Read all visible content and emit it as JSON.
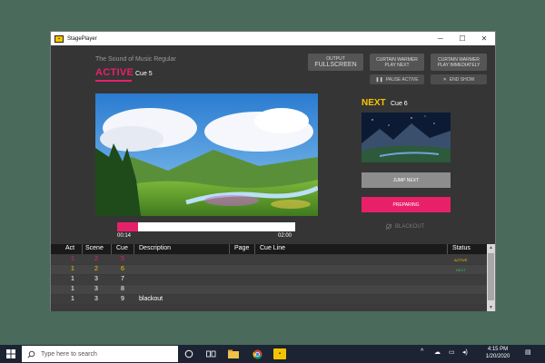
{
  "window": {
    "title": "StagePlayer",
    "minimize": "─",
    "maximize": "☐",
    "close": "✕"
  },
  "active": {
    "show_name": "The Sound of Music Regular",
    "label": "ACTIVE",
    "cue": "Cue 5"
  },
  "controls": {
    "output_line1": "OUTPUT",
    "output_line2": "FULLSCREEN",
    "cw_next_line1": "CURTAIN WARMER",
    "cw_next_line2": "PLAY NEXT",
    "cw_imm_line1": "CURTAIN WARMER",
    "cw_imm_line2": "PLAY IMMEDIATELY",
    "pause_icon": "❚❚",
    "pause_label": "PAUSE ACTIVE",
    "end_icon": "✕",
    "end_label": "END SHOW"
  },
  "playback": {
    "elapsed": "00:14",
    "duration": "02:00",
    "progress_fraction": 0.117
  },
  "next": {
    "label": "NEXT",
    "cue": "Cue 6",
    "jump_label": "JUMP NEXT",
    "preparing_label": "PREPARING",
    "blackout_label": "BLACKOUT"
  },
  "table": {
    "columns": [
      "Act",
      "Scene",
      "Cue",
      "Description",
      "Page",
      "Cue Line",
      "Status"
    ],
    "rows": [
      {
        "act": "1",
        "scene": "2",
        "cue": "5",
        "description": "",
        "page": "",
        "cue_line": "",
        "status": "ACTIVE"
      },
      {
        "act": "1",
        "scene": "2",
        "cue": "6",
        "description": "",
        "page": "",
        "cue_line": "",
        "status": "NEXT"
      },
      {
        "act": "1",
        "scene": "3",
        "cue": "7",
        "description": "",
        "page": "",
        "cue_line": "",
        "status": ""
      },
      {
        "act": "1",
        "scene": "3",
        "cue": "8",
        "description": "",
        "page": "",
        "cue_line": "",
        "status": ""
      },
      {
        "act": "1",
        "scene": "3",
        "cue": "9",
        "description": "blackout",
        "page": "",
        "cue_line": "",
        "status": ""
      }
    ]
  },
  "taskbar": {
    "search_placeholder": "Type here to search",
    "time": "4:15 PM",
    "date": "1/20/2020"
  },
  "colors": {
    "accent_pink": "#e8206a",
    "accent_yellow": "#f5c400",
    "status_active": "#f5c400",
    "status_next": "#36c24a",
    "row_active_text": "#e8206a",
    "row_next_text": "#f5c400"
  }
}
